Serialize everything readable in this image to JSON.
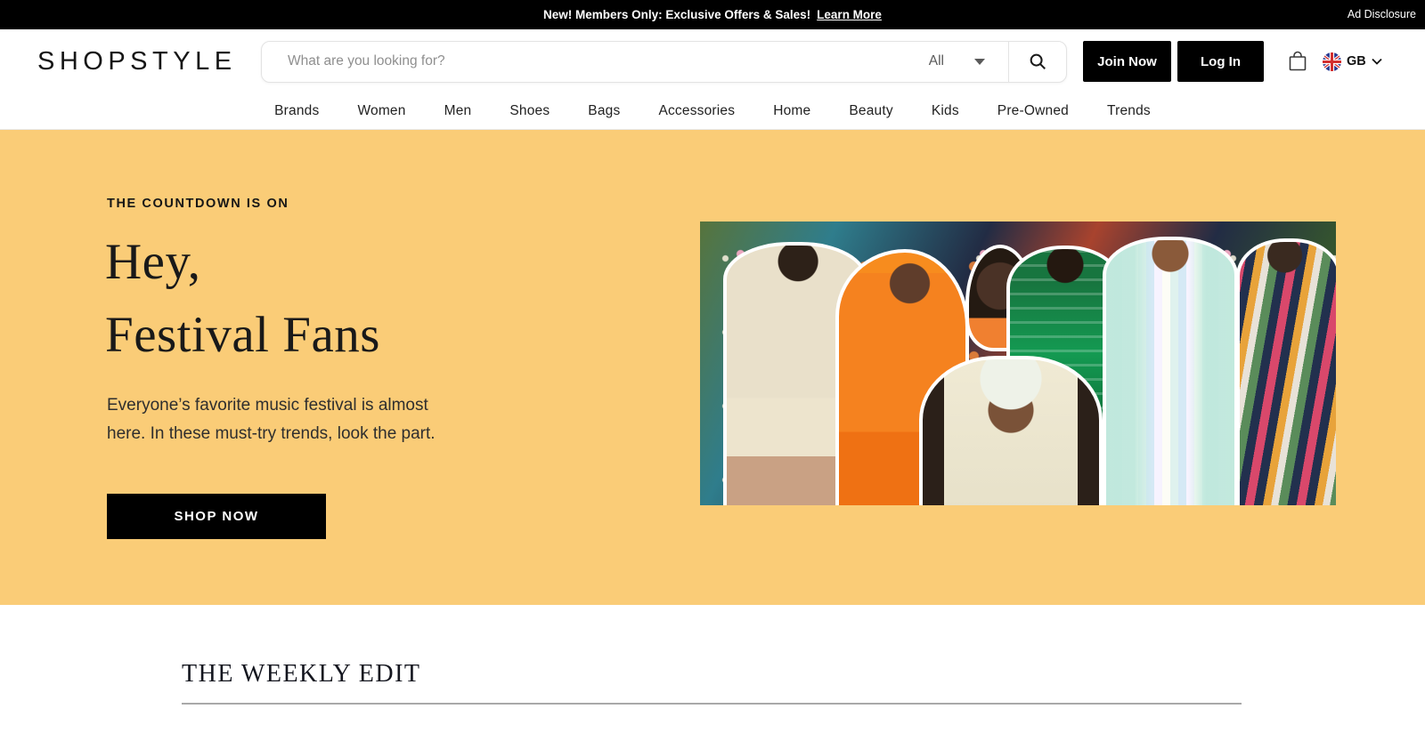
{
  "promo_banner": {
    "text": "New! Members Only: Exclusive Offers & Sales!",
    "link_label": "Learn More",
    "ad_disclosure": "Ad Disclosure"
  },
  "header": {
    "logo": "SHOPSTYLE",
    "search": {
      "placeholder": "What are you looking for?",
      "category": "All"
    },
    "join_label": "Join Now",
    "login_label": "Log In",
    "locale": "GB",
    "icons": {
      "search": "magnifying-glass",
      "bag": "shopping-bag-outline",
      "flag": "gb-union-jack-circle",
      "category_caret": "caret-down",
      "locale_chevron": "chevron-down"
    }
  },
  "nav": {
    "items": [
      {
        "label": "Brands"
      },
      {
        "label": "Women"
      },
      {
        "label": "Men"
      },
      {
        "label": "Shoes"
      },
      {
        "label": "Bags"
      },
      {
        "label": "Accessories"
      },
      {
        "label": "Home"
      },
      {
        "label": "Beauty"
      },
      {
        "label": "Kids"
      },
      {
        "label": "Pre-Owned"
      },
      {
        "label": "Trends"
      }
    ]
  },
  "hero": {
    "eyebrow": "THE COUNTDOWN IS ON",
    "title_line1": "Hey,",
    "title_line2": "Festival Fans",
    "description": "Everyone’s favorite music festival is almost here. In these must-try trends, look the part.",
    "cta_label": "SHOP NOW",
    "image_alt": "collage of people wearing festival fashion over floral background"
  },
  "weekly_edit": {
    "title": "THE WEEKLY EDIT"
  },
  "colors": {
    "promo_bar_bg": "#000000",
    "hero_bg": "#FACC77",
    "button_bg": "#000000",
    "button_text": "#FFFFFF"
  }
}
